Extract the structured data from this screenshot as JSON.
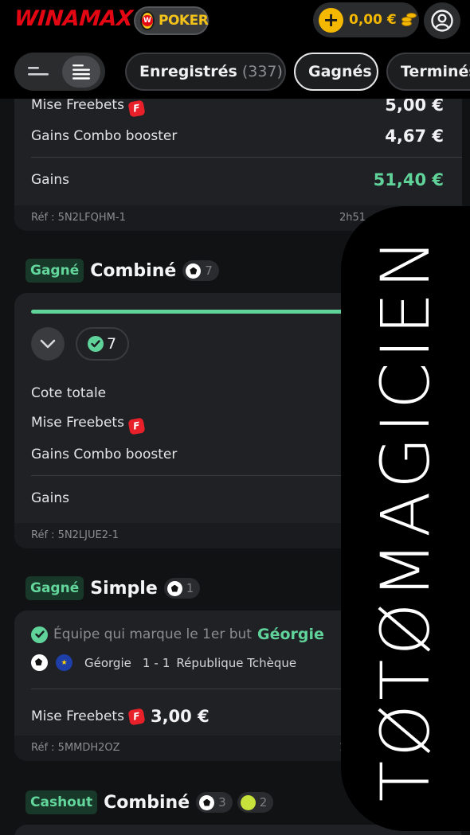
{
  "header": {
    "brand": "WINAMAX",
    "poker_label": "POKER",
    "poker_coin_mark": "W",
    "balance": "0,00 €"
  },
  "filters": {
    "tabs": [
      {
        "label": "Enregistrés",
        "count": "(337)"
      },
      {
        "label": "Gagnés",
        "count": ""
      },
      {
        "label": "Terminés",
        "count": ""
      }
    ],
    "active_tab": "Gagnés"
  },
  "bets": [
    {
      "rows": [
        {
          "label": "Mise Freebets",
          "value": "5,00 €",
          "freebet": true
        },
        {
          "label": "Gains Combo booster",
          "value": "4,67 €"
        },
        {
          "label": "Gains",
          "value": "51,40 €"
        }
      ],
      "ref": "Réf : 5N2LFQHM-1",
      "time": "2h51"
    },
    {
      "status": "Gagné",
      "type": "Combiné",
      "sports": [
        {
          "icon": "football-icon",
          "count": "7"
        }
      ],
      "progress": 1.0,
      "legs_won": "7",
      "rows": [
        {
          "label": "Cote totale"
        },
        {
          "label": "Mise Freebets",
          "freebet": true
        },
        {
          "label": "Gains Combo booster"
        },
        {
          "label": "Gains"
        }
      ],
      "ref": "Réf : 5N2LJUE2-1"
    },
    {
      "status": "Gagné",
      "type": "Simple",
      "sports": [
        {
          "icon": "football-icon",
          "count": "1"
        }
      ],
      "selection_market": "Équipe qui marque le 1er but",
      "selection_pick": "Géorgie",
      "match": {
        "home": "Géorgie",
        "home_score": "1",
        "sep": "-",
        "away_score": "1",
        "away": "République Tchèque"
      },
      "stake_label": "Mise Freebets",
      "stake_value": "3,00 €",
      "ref": "Réf : 5MMDH2OZ",
      "time": "1"
    },
    {
      "status": "Cashout",
      "type": "Combiné",
      "sports": [
        {
          "icon": "football-icon",
          "count": "3"
        },
        {
          "icon": "tennis-ball-icon",
          "count": "2"
        }
      ]
    }
  ],
  "freebet_badge": "F",
  "watermark": "TØTØMAGICIEN",
  "colors": {
    "brand_red": "#e30613",
    "win_green": "#5fd39a",
    "gold": "#f5b800",
    "background": "#111214",
    "card": "#202124"
  }
}
